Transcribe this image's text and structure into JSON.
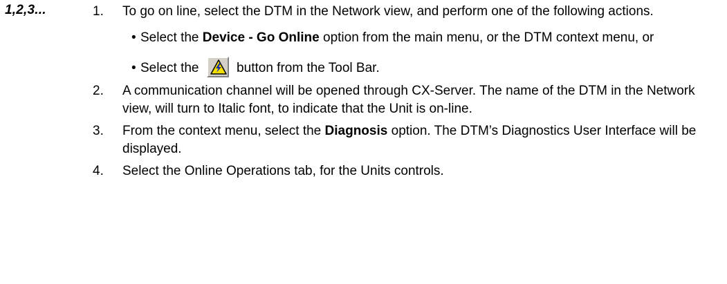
{
  "marker": "1,2,3...",
  "steps": [
    {
      "num": "1.",
      "text": "To go on line, select the DTM in the Network view, and perform one of the following actions.",
      "bullets": [
        {
          "dot": "•",
          "pre": "Select the ",
          "bold": "Device - Go Online",
          "post": " option from the main menu, or the DTM context menu, or"
        },
        {
          "dot": "•",
          "pre": "Select the",
          "icon": "go-online-warning-icon",
          "post": "button from the Tool Bar."
        }
      ]
    },
    {
      "num": "2.",
      "text": "A communication channel will be opened through CX-Server. The name of the DTM in the Network view, will turn to Italic font, to indicate that the Unit is on-line."
    },
    {
      "num": "3.",
      "pre": "From the context menu, select the ",
      "bold": "Diagnosis",
      "post": " option. The DTM’s Diagnostics User Interface will be displayed."
    },
    {
      "num": "4.",
      "text": "Select the Online Operations tab, for the Units controls."
    }
  ],
  "colors": {
    "icon_yellow": "#f5e000",
    "icon_outline": "#000000",
    "button_face": "#d4d0c8",
    "bolt_blue": "#1c2fa8"
  }
}
